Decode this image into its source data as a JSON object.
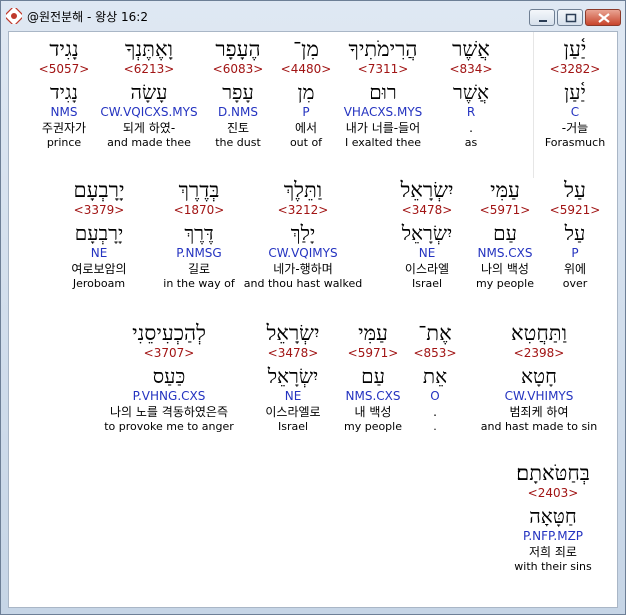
{
  "window": {
    "title": "@원전분해 - 왕상 16:2",
    "colors": {
      "strong": "#a11414",
      "morph": "#2433c0",
      "text": "#000000"
    }
  },
  "rows": [
    [
      {
        "heb": "יַ֫עַן",
        "strong": "<3282>",
        "lemma": "יַ֫עַן",
        "morph": "C",
        "kor": "-거늘",
        "eng": "Forasmuch"
      },
      {
        "heb": "אֲשֶׁר",
        "strong": "<834>",
        "lemma": "אֲשֶׁר",
        "morph": "R",
        "kor": ".",
        "eng": "as"
      },
      {
        "heb": "הֲרִימֹתִיךָ",
        "strong": "<7311>",
        "lemma": "רוּם",
        "morph": "VHACXS.MYS",
        "kor": "내가 너를-들어",
        "eng": "I exalted thee"
      },
      {
        "heb": "מִן־",
        "strong": "<4480>",
        "lemma": "מִן",
        "morph": "P",
        "kor": "에서",
        "eng": "out of"
      },
      {
        "heb": "הֶעָפָר",
        "strong": "<6083>",
        "lemma": "עָפָר",
        "morph": "D.NMS",
        "kor": "진토",
        "eng": "the dust"
      },
      {
        "heb": "וָאֶתֶּנְךָ",
        "strong": "<6213>",
        "lemma": "עָשָׂה",
        "morph": "CW.VQICXS.MYS",
        "kor": "되게 하였-",
        "eng": "and made thee"
      },
      {
        "heb": "נָגִיד",
        "strong": "<5057>",
        "lemma": "נָגִיד",
        "morph": "NMS",
        "kor": "주권자가",
        "eng": "prince"
      }
    ],
    [
      {
        "heb": "עַל",
        "strong": "<5921>",
        "lemma": "עַל",
        "morph": "P",
        "kor": "위에",
        "eng": "over"
      },
      {
        "heb": "עַמִּי",
        "strong": "<5971>",
        "lemma": "עַם",
        "morph": "NMS.CXS",
        "kor": "나의 백성",
        "eng": "my people"
      },
      {
        "heb": "יִשְׂרָאֵל",
        "strong": "<3478>",
        "lemma": "יִשְׂרָאֵל",
        "morph": "NE",
        "kor": "이스라엘",
        "eng": "Israel"
      },
      {
        "heb": "וַתֵּלֶךְ",
        "strong": "<3212>",
        "lemma": "יָלַךְ",
        "morph": "CW.VQIMYS",
        "kor": "네가-행하며",
        "eng": "and thou hast walked"
      },
      {
        "heb": "בְּדֶרֶךְ",
        "strong": "<1870>",
        "lemma": "דֶּרֶךְ",
        "morph": "P.NMSG",
        "kor": "길로",
        "eng": "in the way of"
      },
      {
        "heb": "יָרָבְעָם",
        "strong": "<3379>",
        "lemma": "יָרָבְעָם",
        "morph": "NE",
        "kor": "여로보암의",
        "eng": "Jeroboam"
      }
    ],
    [
      {
        "heb": "וַתַּחֲטִא",
        "strong": "<2398>",
        "lemma": "חָטָא",
        "morph": "CW.VHIMYS",
        "kor": "범죄케 하여",
        "eng": "and hast made to sin"
      },
      {
        "heb": "אֶת־",
        "strong": "<853>",
        "lemma": "אֵת",
        "morph": "O",
        "kor": ".",
        "eng": "."
      },
      {
        "heb": "עַמִּי",
        "strong": "<5971>",
        "lemma": "עַם",
        "morph": "NMS.CXS",
        "kor": "내 백성",
        "eng": "my people"
      },
      {
        "heb": "יִשְׂרָאֵל",
        "strong": "<3478>",
        "lemma": "יִשְׂרָאֵל",
        "morph": "NE",
        "kor": "이스라엘로",
        "eng": "Israel"
      },
      {
        "heb": "לְהַכְעִיסֵנִי",
        "strong": "<3707>",
        "lemma": "כַּעַס",
        "morph": "P.VHNG.CXS",
        "kor": "나의 노를 격동하였은즉",
        "eng": "to provoke me to anger"
      }
    ],
    [
      {
        "heb": "בְּחַטֹּאתָם׃",
        "strong": "<2403>",
        "lemma": "חַטָּאָה",
        "morph": "P.NFP.MZP",
        "kor": "저희 죄로",
        "eng": "with their sins"
      }
    ]
  ]
}
